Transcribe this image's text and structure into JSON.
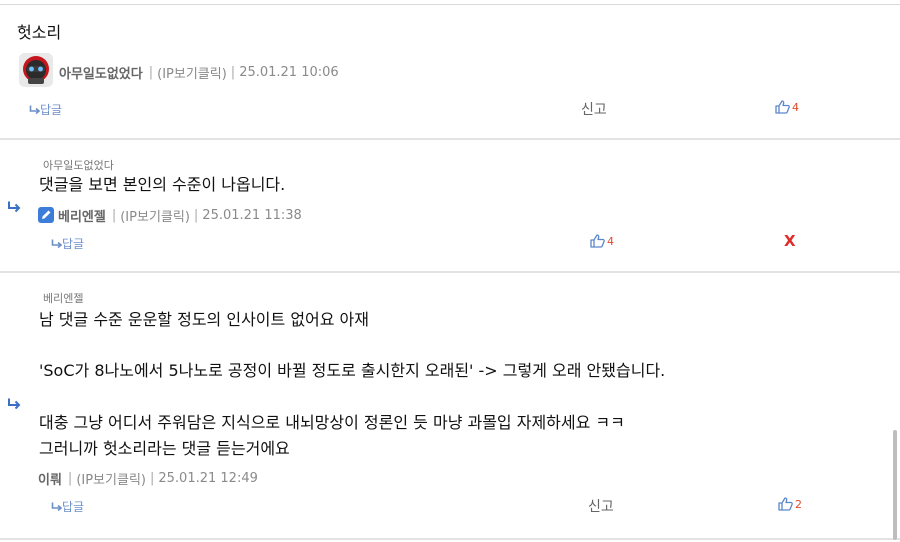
{
  "comments": [
    {
      "content": "헛소리",
      "nickname": "아무일도없었다",
      "ip_click": "(IP보기클릭)",
      "datetime": "25.01.21 10:06",
      "reply_label": "답글",
      "report_label": "신고",
      "likes": "4"
    },
    {
      "parent": "아무일도없었다",
      "content": "댓글을 보면 본인의 수준이 나옵니다.",
      "nickname": "베리엔젤",
      "ip_click": "(IP보기클릭)",
      "datetime": "25.01.21 11:38",
      "reply_label": "답글",
      "likes": "4",
      "delete_label": "X"
    },
    {
      "parent": "베리엔젤",
      "lines": [
        "남 댓글 수준 운운할 정도의 인사이트 없어요 아재",
        "'SoC가 8나노에서 5나노로 공정이 바뀔 정도로 출시한지 오래된' -> 그렇게 오래 안됐습니다.",
        "대충 그냥 어디서 주워담은 지식으로 내뇌망상이 정론인 듯 마냥 과몰입 자제하세요 ㅋㅋ",
        "그러니까 헛소리라는 댓글 듣는거에요"
      ],
      "nickname": "이뤄",
      "ip_click": "(IP보기클릭)",
      "datetime": "25.01.21 12:49",
      "reply_label": "답글",
      "report_label": "신고",
      "likes": "2"
    }
  ],
  "colors": {
    "accent_blue": "#5b87cc",
    "like_count": "#e0492b",
    "delete_x": "#e02b2b",
    "separator": "#e3e3e3"
  },
  "icons": [
    "avatar-character",
    "pencil-badge-icon",
    "reply-arrow-icon",
    "thumbs-up-icon"
  ]
}
